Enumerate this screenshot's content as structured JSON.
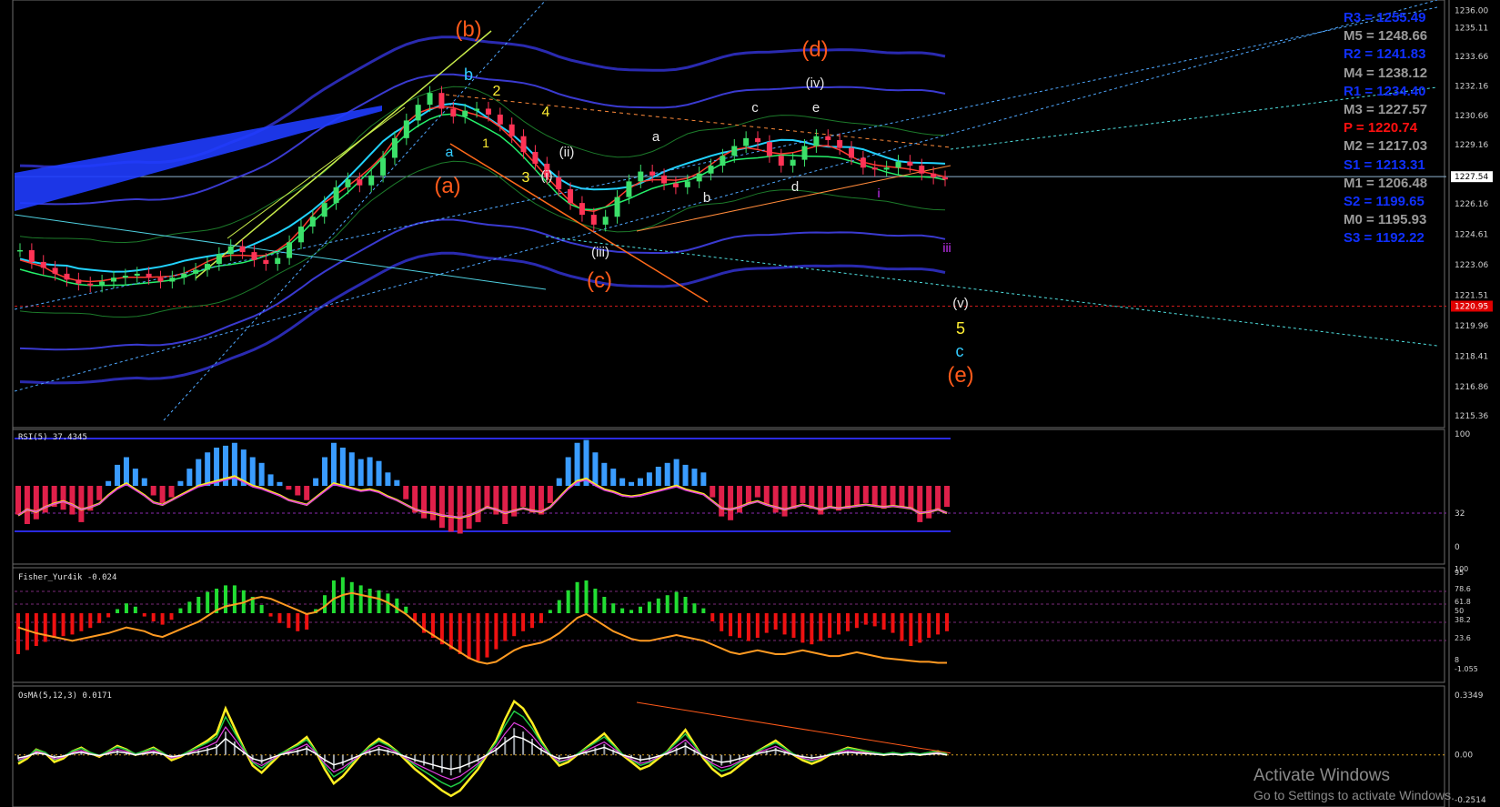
{
  "app": {
    "window_title": ""
  },
  "pivots": [
    {
      "label": "R3",
      "value": "1255.49",
      "color": "#1030ff"
    },
    {
      "label": "M5",
      "value": "1248.66",
      "color": "#9a9a9a"
    },
    {
      "label": "R2",
      "value": "1241.83",
      "color": "#1030ff"
    },
    {
      "label": "M4",
      "value": "1238.12",
      "color": "#9a9a9a"
    },
    {
      "label": "R1",
      "value": "1234.40",
      "color": "#1030ff"
    },
    {
      "label": "M3",
      "value": "1227.57",
      "color": "#9a9a9a"
    },
    {
      "label": "P",
      "value": "1220.74",
      "color": "#ff1010"
    },
    {
      "label": "M2",
      "value": "1217.03",
      "color": "#9a9a9a"
    },
    {
      "label": "S1",
      "value": "1213.31",
      "color": "#1030ff"
    },
    {
      "label": "M1",
      "value": "1206.48",
      "color": "#9a9a9a"
    },
    {
      "label": "S2",
      "value": "1199.65",
      "color": "#1030ff"
    },
    {
      "label": "M0",
      "value": "1195.93",
      "color": "#9a9a9a"
    },
    {
      "label": "S3",
      "value": "1192.22",
      "color": "#1030ff"
    }
  ],
  "indicators": {
    "rsi_title": "RSI(5) 37.4345",
    "fisher_title": "Fisher_Yur4ik -0.024",
    "osma_title": "OsMA(5,12,3) 0.0171"
  },
  "watermark": {
    "title": "Activate Windows",
    "subtitle": "Go to Settings to activate Windows."
  },
  "chart_data": [
    {
      "type": "candlestick",
      "name": "price",
      "y_axis_ticks": [
        "1236.00",
        "1235.11",
        "1233.66",
        "1232.16",
        "1230.66",
        "1229.16",
        "1227.54",
        "1226.16",
        "1224.61",
        "1223.06",
        "1221.51",
        "1220.95",
        "1219.96",
        "1218.41",
        "1216.86",
        "1215.36"
      ],
      "current_price": "1227.54",
      "pivot_marker": "1220.95",
      "close_path": [
        1223.8,
        1223.2,
        1222.9,
        1222.6,
        1222.3,
        1222.1,
        1222.0,
        1222.2,
        1222.4,
        1222.5,
        1222.6,
        1222.4,
        1222.2,
        1222.4,
        1222.6,
        1222.8,
        1223.1,
        1223.6,
        1224.0,
        1223.7,
        1223.3,
        1223.1,
        1223.4,
        1224.2,
        1225.0,
        1225.5,
        1226.2,
        1227.0,
        1227.4,
        1227.1,
        1227.6,
        1228.5,
        1229.5,
        1230.4,
        1231.2,
        1231.8,
        1231.0,
        1230.6,
        1230.9,
        1231.0,
        1230.7,
        1230.2,
        1229.6,
        1228.8,
        1228.2,
        1227.5,
        1226.9,
        1226.2,
        1225.6,
        1225.1,
        1225.5,
        1226.5,
        1227.3,
        1227.8,
        1227.6,
        1227.2,
        1227.0,
        1227.3,
        1227.7,
        1228.1,
        1228.6,
        1229.1,
        1229.5,
        1229.3,
        1228.6,
        1228.1,
        1228.4,
        1229.1,
        1229.6,
        1229.4,
        1229.0,
        1228.5,
        1228.0,
        1227.9,
        1228.0,
        1228.3,
        1228.1,
        1227.7,
        1227.5,
        1227.4
      ],
      "wave_labels": [
        {
          "text": "(b)",
          "color": "#ff5a1a",
          "role": "wave-major"
        },
        {
          "text": "(a)",
          "color": "#ff5a1a",
          "role": "wave-major"
        },
        {
          "text": "(c)",
          "color": "#ff5a1a",
          "role": "wave-major"
        },
        {
          "text": "(d)",
          "color": "#ff5a1a",
          "role": "wave-major"
        },
        {
          "text": "(e)",
          "color": "#ff5a1a",
          "role": "wave-major"
        },
        {
          "text": "b",
          "color": "#33ccff",
          "role": "wave-minor"
        },
        {
          "text": "a",
          "color": "#33ccff",
          "role": "wave-minor"
        },
        {
          "text": "c",
          "color": "#33ccff",
          "role": "wave-minor"
        },
        {
          "text": "2",
          "color": "#ffee33",
          "role": "wave-count"
        },
        {
          "text": "4",
          "color": "#ffee33",
          "role": "wave-count"
        },
        {
          "text": "1",
          "color": "#ffee33",
          "role": "wave-count"
        },
        {
          "text": "3",
          "color": "#ffee33",
          "role": "wave-count"
        },
        {
          "text": "5",
          "color": "#ffee33",
          "role": "wave-count"
        },
        {
          "text": "(ii)",
          "color": "#e8e8e8",
          "role": "wave-sub"
        },
        {
          "text": "(i)",
          "color": "#e8e8e8",
          "role": "wave-sub"
        },
        {
          "text": "(iii)",
          "color": "#e8e8e8",
          "role": "wave-sub"
        },
        {
          "text": "(iv)",
          "color": "#e8e8e8",
          "role": "wave-sub"
        },
        {
          "text": "(v)",
          "color": "#e8e8e8",
          "role": "wave-sub"
        },
        {
          "text": "a",
          "color": "#e8e8e8",
          "role": "wave-letter"
        },
        {
          "text": "b",
          "color": "#e8e8e8",
          "role": "wave-letter"
        },
        {
          "text": "c",
          "color": "#e8e8e8",
          "role": "wave-letter"
        },
        {
          "text": "d",
          "color": "#e8e8e8",
          "role": "wave-letter"
        },
        {
          "text": "e",
          "color": "#e8e8e8",
          "role": "wave-letter"
        },
        {
          "text": "i",
          "color": "#cc33ff",
          "role": "wave-small"
        },
        {
          "text": "iii",
          "color": "#cc33ff",
          "role": "wave-small"
        }
      ]
    },
    {
      "type": "bar",
      "name": "rsi",
      "y_axis_ticks": [
        "100",
        "32",
        "0"
      ],
      "values": [
        -30,
        -40,
        -35,
        -28,
        -22,
        -25,
        -30,
        -38,
        -26,
        -15,
        5,
        22,
        30,
        18,
        8,
        -10,
        -18,
        -12,
        5,
        18,
        28,
        35,
        40,
        42,
        45,
        38,
        30,
        24,
        12,
        4,
        -4,
        -10,
        -15,
        8,
        30,
        45,
        40,
        35,
        28,
        30,
        26,
        14,
        6,
        -14,
        -28,
        -34,
        -36,
        -44,
        -48,
        -50,
        -45,
        -38,
        -24,
        -30,
        -40,
        -32,
        -22,
        -28,
        -30,
        -18,
        8,
        30,
        45,
        48,
        35,
        24,
        18,
        8,
        4,
        8,
        14,
        20,
        24,
        28,
        22,
        18,
        14,
        -12,
        -32,
        -36,
        -28,
        -18,
        -12,
        -20,
        -28,
        -32,
        -24,
        -18,
        -24,
        -30,
        -22,
        -26,
        -24,
        -20,
        -18,
        -20,
        -24,
        -20,
        -22,
        -24,
        -38,
        -34,
        -26,
        -22
      ],
      "line": [
        35,
        40,
        38,
        42,
        45,
        47,
        44,
        40,
        42,
        45,
        52,
        58,
        62,
        57,
        52,
        46,
        44,
        48,
        52,
        56,
        60,
        62,
        64,
        66,
        68,
        64,
        60,
        58,
        55,
        52,
        48,
        46,
        44,
        50,
        56,
        62,
        60,
        58,
        56,
        57,
        55,
        51,
        48,
        44,
        40,
        38,
        37,
        35,
        34,
        33,
        35,
        38,
        42,
        40,
        37,
        39,
        41,
        39,
        38,
        42,
        50,
        58,
        64,
        66,
        61,
        57,
        55,
        52,
        51,
        52,
        54,
        56,
        58,
        60,
        57,
        55,
        53,
        47,
        41,
        40,
        42,
        45,
        47,
        44,
        42,
        40,
        42,
        44,
        42,
        40,
        42,
        41,
        42,
        43,
        44,
        43,
        42,
        43,
        42,
        41,
        37,
        38,
        40,
        37
      ]
    },
    {
      "type": "bar",
      "name": "fisher",
      "y_axis_ticks": [
        "100",
        "95",
        "78.6",
        "61.8",
        "50",
        "38.2",
        "23.6",
        "8",
        "-1.055"
      ],
      "values": [
        -50,
        -45,
        -40,
        -35,
        -30,
        -28,
        -26,
        -22,
        -18,
        -12,
        -5,
        5,
        12,
        8,
        -4,
        -10,
        -14,
        -8,
        6,
        14,
        20,
        26,
        30,
        34,
        34,
        28,
        20,
        10,
        -4,
        -12,
        -18,
        -22,
        -20,
        5,
        22,
        40,
        44,
        38,
        34,
        30,
        28,
        24,
        18,
        8,
        -10,
        -24,
        -30,
        -38,
        -44,
        -50,
        -56,
        -58,
        -54,
        -44,
        -34,
        -28,
        -22,
        -18,
        -12,
        4,
        16,
        28,
        38,
        40,
        30,
        20,
        12,
        6,
        4,
        8,
        14,
        18,
        22,
        26,
        20,
        12,
        6,
        -10,
        -22,
        -28,
        -30,
        -34,
        -30,
        -24,
        -20,
        -26,
        -30,
        -36,
        -38,
        -34,
        -30,
        -26,
        -22,
        -18,
        -14,
        -16,
        -20,
        -24,
        -34,
        -40,
        -36,
        -30,
        -26,
        -22
      ],
      "line": [
        48,
        45,
        42,
        40,
        38,
        36,
        34,
        36,
        38,
        40,
        42,
        45,
        48,
        46,
        44,
        40,
        38,
        42,
        46,
        50,
        54,
        60,
        66,
        70,
        72,
        74,
        78,
        80,
        78,
        74,
        70,
        66,
        62,
        64,
        70,
        78,
        82,
        84,
        82,
        80,
        78,
        74,
        68,
        62,
        54,
        46,
        40,
        34,
        28,
        22,
        16,
        12,
        10,
        12,
        18,
        24,
        28,
        30,
        32,
        36,
        42,
        50,
        58,
        62,
        56,
        50,
        44,
        40,
        36,
        34,
        34,
        36,
        38,
        40,
        38,
        36,
        34,
        30,
        26,
        22,
        20,
        22,
        24,
        22,
        20,
        20,
        22,
        24,
        22,
        20,
        18,
        18,
        20,
        22,
        20,
        18,
        16,
        15,
        14,
        13,
        12,
        12,
        11,
        11
      ]
    },
    {
      "type": "line",
      "name": "osma",
      "y_axis_ticks": [
        "0.3349",
        "0.00",
        "-0.2514"
      ],
      "values": [
        -0.05,
        -0.02,
        0.03,
        0.01,
        -0.04,
        -0.02,
        0.02,
        0.04,
        0.01,
        -0.01,
        0.02,
        0.05,
        0.03,
        0.0,
        0.02,
        0.04,
        0.01,
        -0.03,
        -0.01,
        0.02,
        0.05,
        0.08,
        0.12,
        0.26,
        0.15,
        0.04,
        -0.06,
        -0.1,
        -0.05,
        0.0,
        0.03,
        0.06,
        0.1,
        0.02,
        -0.08,
        -0.16,
        -0.12,
        -0.06,
        0.0,
        0.05,
        0.09,
        0.06,
        0.02,
        -0.03,
        -0.08,
        -0.12,
        -0.16,
        -0.2,
        -0.23,
        -0.2,
        -0.14,
        -0.08,
        0.0,
        0.08,
        0.2,
        0.3,
        0.26,
        0.18,
        0.08,
        0.0,
        -0.06,
        -0.04,
        0.0,
        0.04,
        0.08,
        0.12,
        0.06,
        0.0,
        -0.04,
        -0.08,
        -0.06,
        -0.02,
        0.02,
        0.08,
        0.14,
        0.06,
        -0.02,
        -0.08,
        -0.12,
        -0.1,
        -0.06,
        -0.02,
        0.02,
        0.05,
        0.08,
        0.04,
        0.0,
        -0.03,
        -0.05,
        -0.03,
        0.0,
        0.02,
        0.04,
        0.03,
        0.02,
        0.01,
        0.0,
        0.01,
        0.0,
        0.01,
        0.0,
        0.01,
        0.02,
        0.0
      ],
      "ylim": [
        -0.2514,
        0.3349
      ]
    }
  ]
}
